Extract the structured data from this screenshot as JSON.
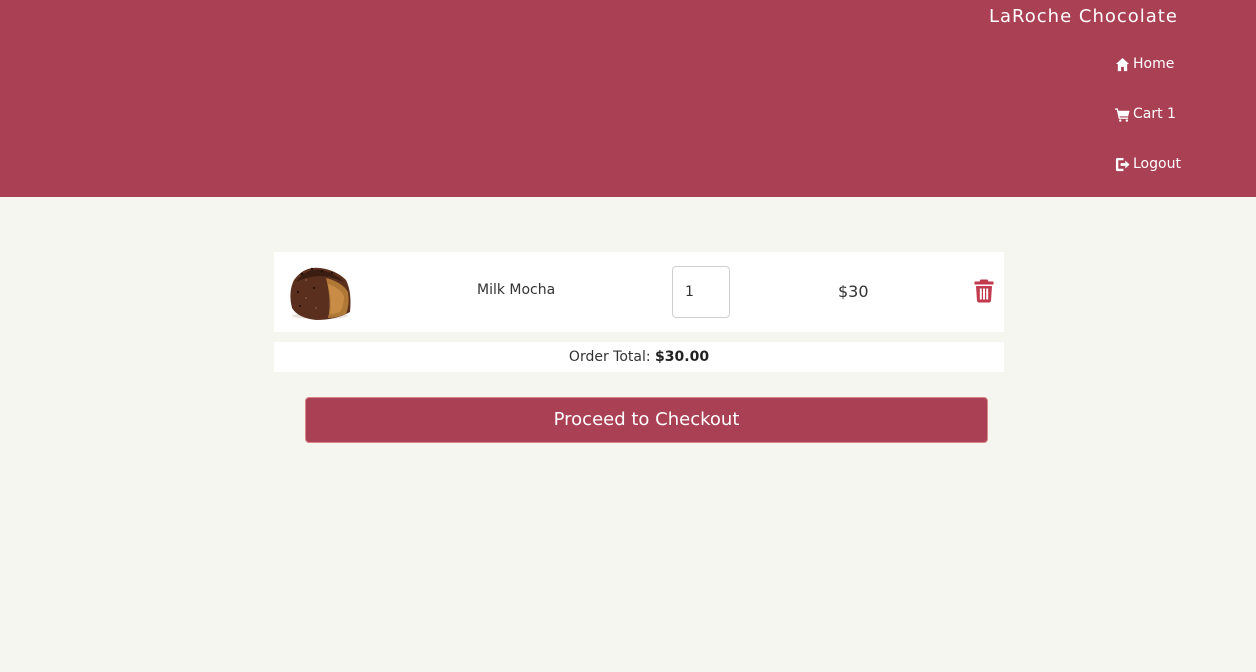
{
  "header": {
    "brand": "LaRoche Chocolate",
    "nav": {
      "home": "Home",
      "cart": "Cart 1",
      "logout": "Logout"
    }
  },
  "cart": {
    "items": [
      {
        "name": "Milk Mocha",
        "quantity": "1",
        "price": "$30"
      }
    ],
    "order_total_label": "Order Total:",
    "order_total_value": "$30.00",
    "checkout_label": "Proceed to Checkout"
  },
  "colors": {
    "header_bg": "#a94054",
    "page_bg": "#f5f6f0",
    "trash_icon": "#c23a4e"
  },
  "icons": [
    "home-icon",
    "cart-icon",
    "logout-icon",
    "trash-icon"
  ]
}
